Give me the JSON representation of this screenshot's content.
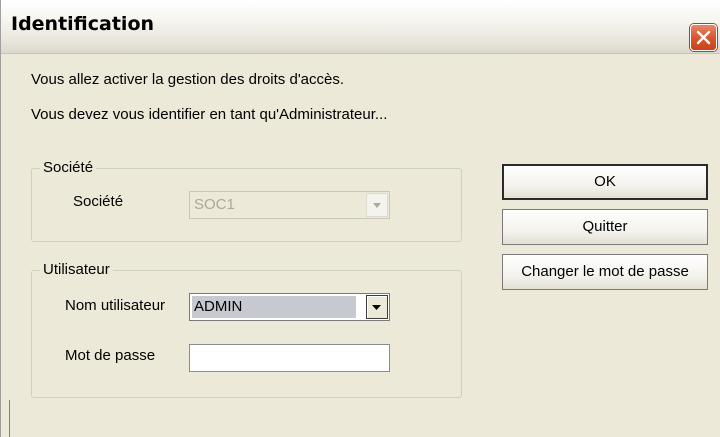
{
  "window": {
    "title": "Identification",
    "close_icon": "close-x-icon"
  },
  "message": {
    "line1": "Vous allez activer la gestion des droits d'accès.",
    "line2": "Vous devez vous identifier en tant qu'Administrateur..."
  },
  "societe_group": {
    "legend": "Société",
    "field_label": "Société",
    "value": "SOC1",
    "enabled": false
  },
  "utilisateur_group": {
    "legend": "Utilisateur",
    "user_label": "Nom utilisateur",
    "user_value": "ADMIN",
    "password_label": "Mot de passe",
    "password_value": ""
  },
  "buttons": {
    "ok": "OK",
    "quit": "Quitter",
    "change_password": "Changer le mot de passe"
  },
  "colors": {
    "dialog_bg": "#ece9d8",
    "close_button": "#d9582f",
    "selection_bg": "#c7c9d0"
  }
}
